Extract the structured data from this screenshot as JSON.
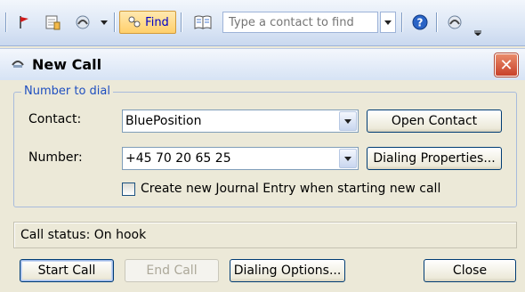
{
  "toolbar": {
    "find_label": "Find",
    "search_placeholder": "Type a contact to find"
  },
  "dialog": {
    "title": "New Call",
    "group_title": "Number to dial",
    "contact_label": "Contact:",
    "contact_value": "BluePosition",
    "number_label": "Number:",
    "number_value": "+45 70 20 65 25",
    "open_contact_label": "Open Contact",
    "dialing_properties_label": "Dialing Properties...",
    "journal_checkbox_label": "Create new Journal Entry when starting new call",
    "journal_checked": false,
    "status_label": "Call status: On hook",
    "buttons": {
      "start_call": "Start Call",
      "end_call": "End Call",
      "dialing_options": "Dialing Options...",
      "close": "Close"
    }
  },
  "colors": {
    "window_bg": "#ECE9D8",
    "group_title": "#1f4fc0",
    "find_highlight": "#ffcf6b"
  }
}
